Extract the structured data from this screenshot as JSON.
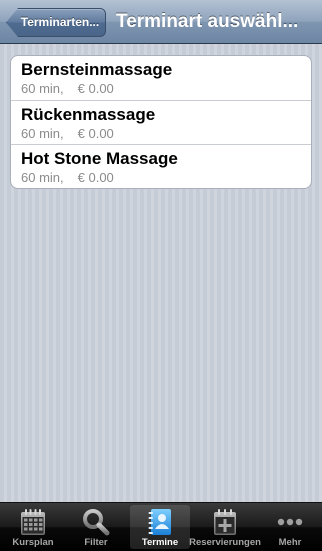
{
  "navbar": {
    "back_label": "Terminarten...",
    "title": "Terminart auswähl..."
  },
  "items": [
    {
      "title": "Bernsteinmassage",
      "duration": "60 min,",
      "price": "€ 0.00"
    },
    {
      "title": "Rückenmassage",
      "duration": "60 min,",
      "price": "€ 0.00"
    },
    {
      "title": "Hot Stone Massage",
      "duration": "60 min,",
      "price": "€ 0.00"
    }
  ],
  "tabbar": {
    "tabs": [
      {
        "label": "Kursplan",
        "icon": "calendar-icon"
      },
      {
        "label": "Filter",
        "icon": "magnifier-icon"
      },
      {
        "label": "Termine",
        "icon": "contacts-book-icon",
        "active": true
      },
      {
        "label": "Reservierungen",
        "icon": "calendar-add-icon"
      },
      {
        "label": "Mehr",
        "icon": "more-dots-icon"
      }
    ]
  }
}
